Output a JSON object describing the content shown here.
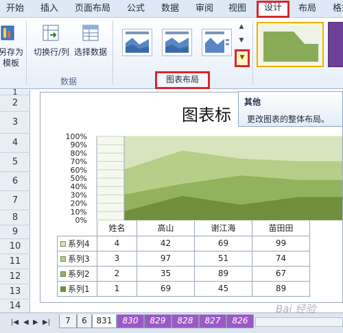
{
  "ribbon_tabs": [
    {
      "label": "开始"
    },
    {
      "label": "插入"
    },
    {
      "label": "页面布局"
    },
    {
      "label": "公式"
    },
    {
      "label": "数据"
    },
    {
      "label": "审阅"
    },
    {
      "label": "视图"
    },
    {
      "label": "设计"
    },
    {
      "label": "布局"
    },
    {
      "label": "格式"
    }
  ],
  "ribbon": {
    "save_template_line1": "另存为",
    "save_template_line2": "模板",
    "switch_row_col": "切换行/列",
    "select_data": "选择数据",
    "data_group_label": "数据",
    "chart_layout_group_label": "图表布局"
  },
  "tooltip": {
    "title": "其他",
    "body": "更改图表的整体布局。"
  },
  "row_numbers": [
    "1",
    "2",
    "3",
    "4",
    "5",
    "6",
    "7",
    "8",
    "9",
    "10",
    "11",
    "12",
    "13",
    "14"
  ],
  "chart_data": {
    "type": "area",
    "title": "图表标",
    "y_tick_labels": [
      "100%",
      "90%",
      "80%",
      "70%",
      "60%",
      "50%",
      "40%",
      "30%",
      "20%",
      "10%",
      "0%"
    ],
    "ylim": [
      0,
      100
    ],
    "categories": [
      "姓名",
      "高山",
      "谢江海",
      "苗田田"
    ],
    "series": [
      {
        "name": "系列4",
        "values": [
          4,
          42,
          69,
          99
        ],
        "color": "#d7e4bd"
      },
      {
        "name": "系列3",
        "values": [
          3,
          97,
          51,
          74
        ],
        "color": "#b6cf88"
      },
      {
        "name": "系列2",
        "values": [
          2,
          35,
          89,
          67
        ],
        "color": "#93b25d"
      },
      {
        "name": "系列1",
        "values": [
          1,
          69,
          45,
          89
        ],
        "color": "#6f8f3d"
      }
    ],
    "stacked_percent": true,
    "grid": true
  },
  "sheet_tabs": [
    "7",
    "6",
    "831",
    "830",
    "829",
    "828",
    "827",
    "826"
  ],
  "active_sheet": "831",
  "watermark": "Bai 经验"
}
